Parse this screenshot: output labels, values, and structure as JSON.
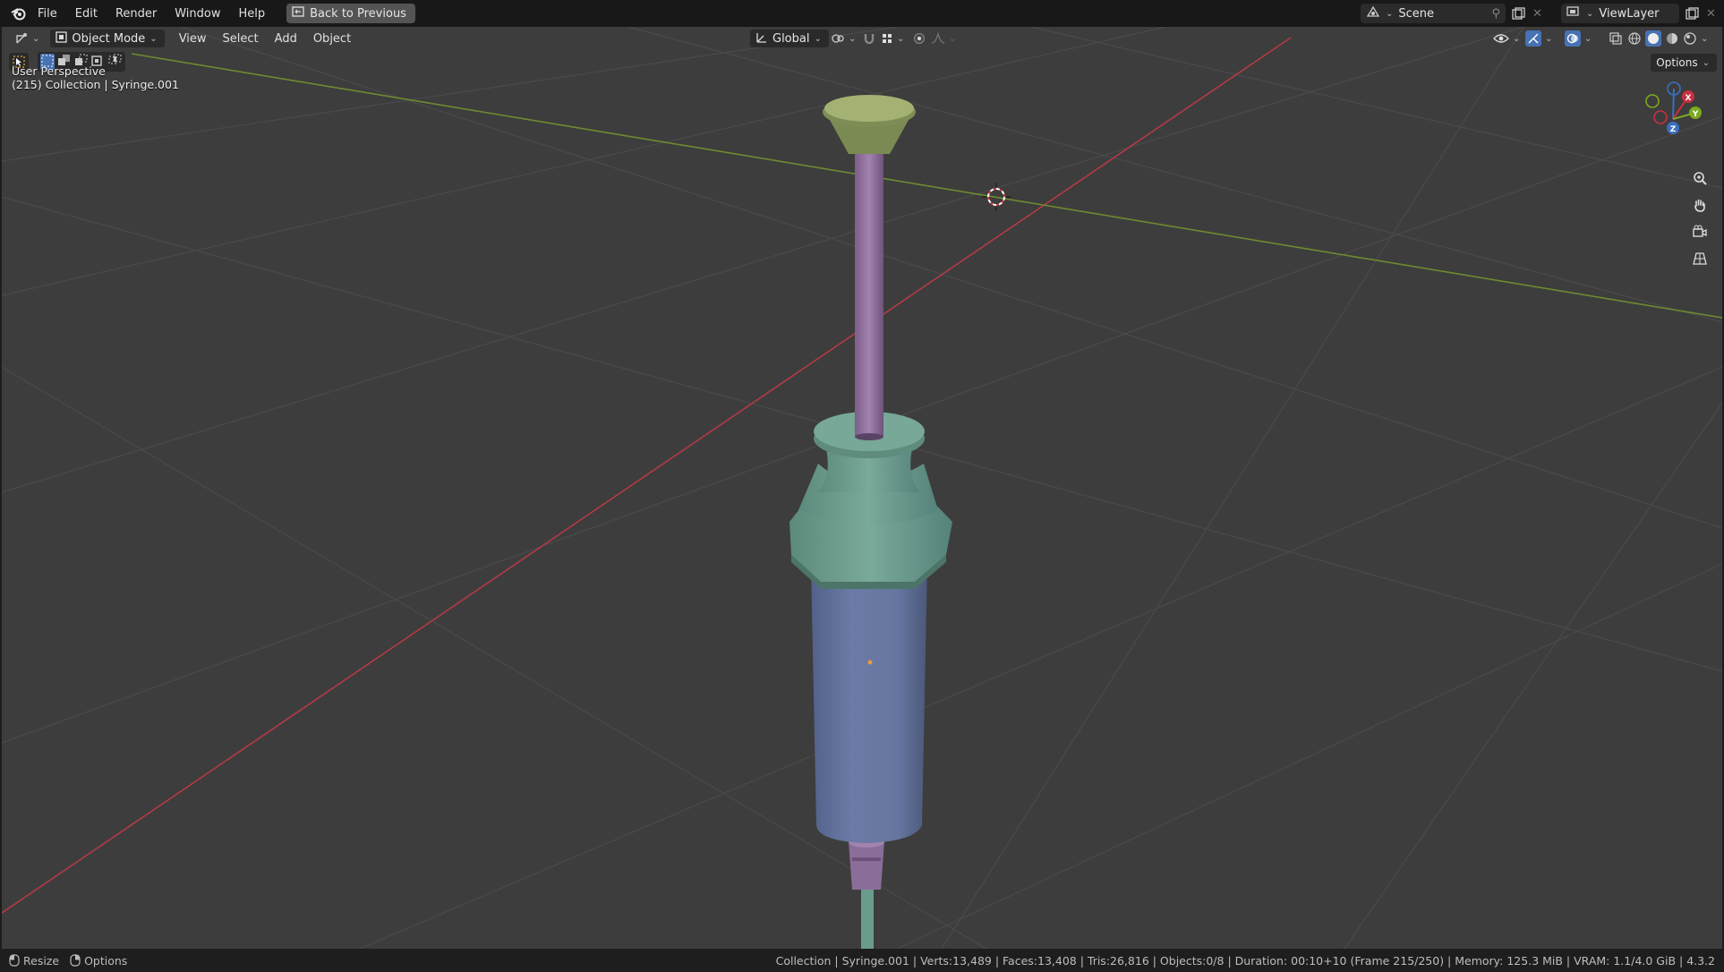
{
  "menu": {
    "items": [
      "File",
      "Edit",
      "Render",
      "Window",
      "Help"
    ],
    "back_button": "Back to Previous"
  },
  "top_right": {
    "scene": "Scene",
    "view_layer": "ViewLayer"
  },
  "viewport_header": {
    "mode": "Object Mode",
    "menus": [
      "View",
      "Select",
      "Add",
      "Object"
    ],
    "transform_orientation": "Global",
    "options_label": "Options"
  },
  "viewport_overlay": {
    "perspective": "User Perspective",
    "collection_info": "(215) Collection | Syringe.001"
  },
  "gizmo": {
    "x": "X",
    "y": "Y",
    "z": "Z"
  },
  "statusbar": {
    "resize_label": "Resize",
    "options_label": "Options",
    "stats": "Collection | Syringe.001 | Verts:13,489 | Faces:13,408 | Tris:26,816 | Objects:0/8 | Duration: 00:10+10 (Frame 215/250) | Memory: 125.3 MiB | VRAM: 1.1/4.0 GiB | 4.3.2"
  },
  "colors": {
    "viewport_bg": "#3d3d3d",
    "axis_x": "#b33a47",
    "axis_y": "#6d8b2f",
    "plunger_rod": "#8c6d99",
    "plunger_cap": "#8c9c5f",
    "flange": "#6a9c8c",
    "barrel": "#6676a0"
  }
}
